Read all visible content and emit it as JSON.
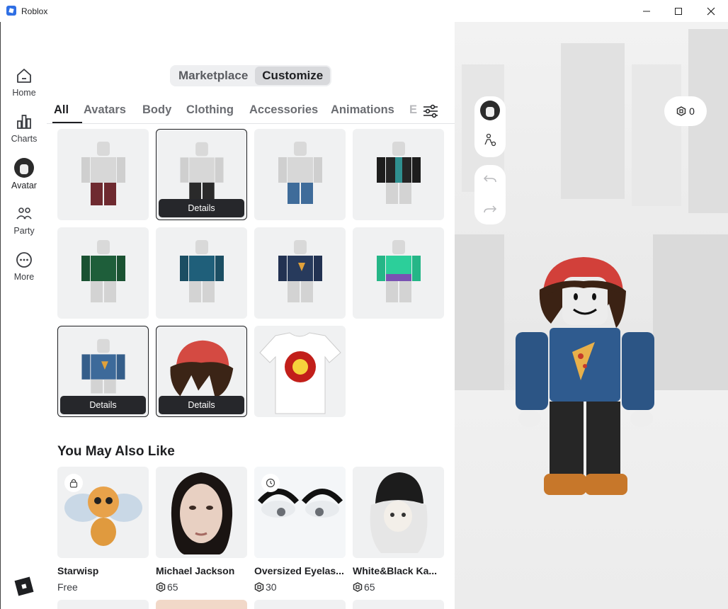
{
  "window": {
    "title": "Roblox",
    "minimize": "—",
    "maximize": "☐",
    "close": "✕"
  },
  "nav": [
    {
      "label": "Home",
      "icon": "home-icon"
    },
    {
      "label": "Charts",
      "icon": "charts-icon"
    },
    {
      "label": "Avatar",
      "icon": "avatar-icon"
    },
    {
      "label": "Party",
      "icon": "party-icon"
    },
    {
      "label": "More",
      "icon": "more-icon"
    }
  ],
  "segment": {
    "marketplace": "Marketplace",
    "customize": "Customize"
  },
  "tabs": [
    "All",
    "Avatars",
    "Body",
    "Clothing",
    "Accessories",
    "Animations",
    "E"
  ],
  "grid": {
    "details_label": "Details"
  },
  "recommend": {
    "title": "You May Also Like",
    "items": [
      {
        "name": "Starwisp",
        "price": "Free"
      },
      {
        "name": "Michael Jackson",
        "price": "65"
      },
      {
        "name": "Oversized Eyelas...",
        "price": "30"
      },
      {
        "name": "White&Black Ka...",
        "price": "65"
      }
    ]
  },
  "viewport": {
    "robux_balance": "0"
  },
  "colors": {
    "accent": "#1e1f22",
    "tile_bg": "#f0f1f2",
    "details_bg": "#26272b"
  }
}
